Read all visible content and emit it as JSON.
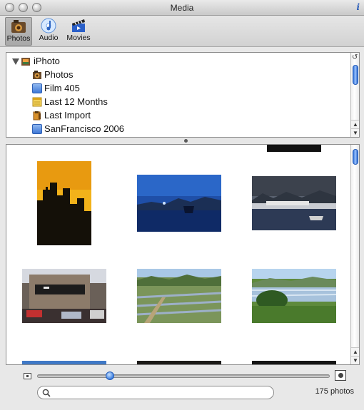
{
  "window": {
    "title": "Media",
    "info_label": "i"
  },
  "toolbar": {
    "tabs": [
      {
        "label": "Photos",
        "icon": "camera-icon",
        "active": true
      },
      {
        "label": "Audio",
        "icon": "music-note-icon",
        "active": false
      },
      {
        "label": "Movies",
        "icon": "clapperboard-icon",
        "active": false
      }
    ]
  },
  "source_list": {
    "root": "iPhoto",
    "items": [
      {
        "label": "Photos",
        "icon": "photos-icon"
      },
      {
        "label": "Film 405",
        "icon": "album-icon"
      },
      {
        "label": "Last 12 Months",
        "icon": "calendar-icon"
      },
      {
        "label": "Last Import",
        "icon": "import-icon"
      },
      {
        "label": "SanFrancisco 2006",
        "icon": "album-icon"
      }
    ]
  },
  "photos": {
    "thumbnails": [
      {
        "subject": "yellow sky skyline silhouette"
      },
      {
        "subject": "harbor at dusk"
      },
      {
        "subject": "harbor with cloudy sky"
      },
      {
        "subject": "street corner building"
      },
      {
        "subject": "green valley fields"
      },
      {
        "subject": "flooded fields landscape"
      }
    ]
  },
  "footer": {
    "search_placeholder": "",
    "count_text": "175 photos"
  },
  "colors": {
    "accent": "#3d7fe0",
    "selection_blue": "#2f6fd6"
  }
}
